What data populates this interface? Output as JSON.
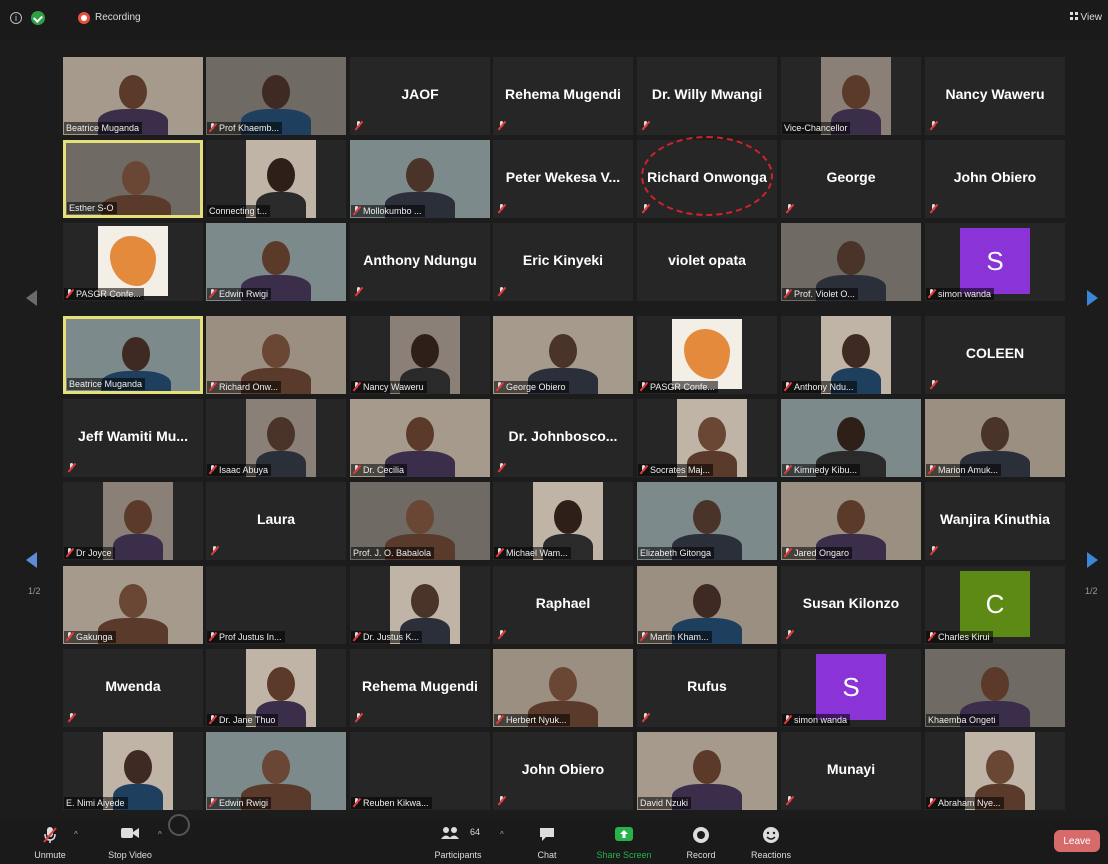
{
  "topbar": {
    "recording_label": "Recording",
    "view_label": "View"
  },
  "pager": {
    "left_label": "1/2",
    "right_label": "1/2"
  },
  "grid": [
    [
      {
        "label": "Beatrice Muganda",
        "kind": "video",
        "muted": false
      },
      {
        "label": "Prof Khaemb...",
        "kind": "video",
        "muted": true
      },
      {
        "center": "JAOF",
        "kind": "name",
        "muted": true
      },
      {
        "center": "Rehema Mugendi",
        "kind": "name",
        "muted": true
      },
      {
        "center": "Dr. Willy Mwangi",
        "kind": "name",
        "muted": true
      },
      {
        "label": "Vice-Chancellor",
        "kind": "video",
        "muted": false
      },
      {
        "center": "Nancy Waweru",
        "kind": "name",
        "muted": true
      }
    ],
    [
      {
        "label": "Esther S-O",
        "kind": "video",
        "muted": false,
        "active": true
      },
      {
        "label": "Connecting t...",
        "kind": "video",
        "muted": false
      },
      {
        "label": "Mollokumbo ...",
        "kind": "video",
        "muted": true
      },
      {
        "center": "Peter Wekesa V...",
        "kind": "name",
        "muted": true
      },
      {
        "center": "Richard Onwonga",
        "kind": "name",
        "muted": true
      },
      {
        "center": "George",
        "kind": "name",
        "muted": true
      },
      {
        "center": "John Obiero",
        "kind": "name",
        "muted": true
      }
    ],
    [
      {
        "label": "PASGR Confe...",
        "kind": "logo",
        "muted": true
      },
      {
        "label": "Edwin Rwigi",
        "kind": "video",
        "muted": true
      },
      {
        "center": "Anthony Ndungu",
        "kind": "name",
        "muted": true
      },
      {
        "center": "Eric Kinyeki",
        "kind": "name",
        "muted": true
      },
      {
        "center": "violet opata",
        "kind": "name",
        "muted": false
      },
      {
        "label": "Prof. Violet O...",
        "kind": "video",
        "muted": true
      },
      {
        "label": "simon wanda",
        "kind": "avatar",
        "letter": "S",
        "muted": true
      }
    ],
    [
      {
        "label": "Beatrice Muganda",
        "kind": "video",
        "muted": false,
        "active": true
      },
      {
        "label": "Richard Onw...",
        "kind": "video",
        "muted": true
      },
      {
        "label": "Nancy Waweru",
        "kind": "video",
        "muted": true
      },
      {
        "label": "George Obiero",
        "kind": "video",
        "muted": true
      },
      {
        "label": "PASGR Confe...",
        "kind": "logo",
        "muted": true
      },
      {
        "label": "Anthony Ndu...",
        "kind": "video",
        "muted": true
      },
      {
        "center": "COLEEN",
        "kind": "name",
        "muted": true
      }
    ],
    [
      {
        "center": "Jeff Wamiti Mu...",
        "kind": "name",
        "muted": true
      },
      {
        "label": "Isaac Abuya",
        "kind": "video",
        "muted": true
      },
      {
        "label": "Dr. Cecilia",
        "kind": "video",
        "muted": true
      },
      {
        "center": "Dr. Johnbosco...",
        "kind": "name",
        "muted": true
      },
      {
        "label": "Socrates Maj...",
        "kind": "video",
        "muted": true
      },
      {
        "label": "Kimnedy Kibu...",
        "kind": "video",
        "muted": true
      },
      {
        "label": "Marion Amuk...",
        "kind": "video",
        "muted": true
      }
    ],
    [
      {
        "label": "Dr Joyce",
        "kind": "video",
        "muted": true
      },
      {
        "center": "Laura",
        "kind": "name",
        "muted": true
      },
      {
        "label": "Prof. J. O. Babalola",
        "kind": "video",
        "muted": false
      },
      {
        "label": "Michael Wam...",
        "kind": "video",
        "muted": true
      },
      {
        "label": "Elizabeth Gitonga",
        "kind": "video",
        "muted": false
      },
      {
        "label": "Jared Ongaro",
        "kind": "video",
        "muted": true
      },
      {
        "center": "Wanjira Kinuthia",
        "kind": "name",
        "muted": true
      }
    ],
    [
      {
        "label": "Gakunga",
        "kind": "video",
        "muted": true
      },
      {
        "label": "Prof Justus In...",
        "kind": "dark",
        "muted": true
      },
      {
        "label": "Dr. Justus K...",
        "kind": "video",
        "muted": true
      },
      {
        "center": "Raphael",
        "kind": "name",
        "muted": true
      },
      {
        "label": "Martin Kham...",
        "kind": "video",
        "muted": true
      },
      {
        "center": "Susan Kilonzo",
        "kind": "name",
        "muted": true
      },
      {
        "label": "Charles Kirui",
        "kind": "avatar",
        "letter": "C",
        "muted": true
      }
    ],
    [
      {
        "center": "Mwenda",
        "kind": "name",
        "muted": true
      },
      {
        "label": "Dr. Jane Thuo",
        "kind": "video",
        "muted": true
      },
      {
        "center": "Rehema Mugendi",
        "kind": "name",
        "muted": true
      },
      {
        "label": "Herbert Nyuk...",
        "kind": "video",
        "muted": true
      },
      {
        "center": "Rufus",
        "kind": "name",
        "muted": true
      },
      {
        "label": "simon wanda",
        "kind": "avatar",
        "letter": "S",
        "muted": true
      },
      {
        "label": "Khaemba Ongeti",
        "kind": "video",
        "muted": false
      }
    ],
    [
      {
        "label": "E. Nimi Aiyede",
        "kind": "video",
        "muted": false
      },
      {
        "label": "Edwin Rwigi",
        "kind": "video",
        "muted": true
      },
      {
        "label": "Reuben Kikwa...",
        "kind": "dark",
        "muted": true
      },
      {
        "center": "John Obiero",
        "kind": "name",
        "muted": true
      },
      {
        "label": "David Nzuki",
        "kind": "video",
        "muted": false
      },
      {
        "center": "Munayi",
        "kind": "name",
        "muted": true
      },
      {
        "label": "Abraham Nye...",
        "kind": "video",
        "muted": true
      }
    ]
  ],
  "toolbar": {
    "unmute": "Unmute",
    "stop_video": "Stop Video",
    "participants": "Participants",
    "participants_count": "64",
    "chat": "Chat",
    "share_screen": "Share Screen",
    "record": "Record",
    "reactions": "Reactions",
    "leave": "Leave"
  },
  "colors": {
    "avatar_s": "#8a34d8",
    "avatar_c": "#5c8a15",
    "active_border": "#e6e07a",
    "highlight": "#d3222a"
  }
}
